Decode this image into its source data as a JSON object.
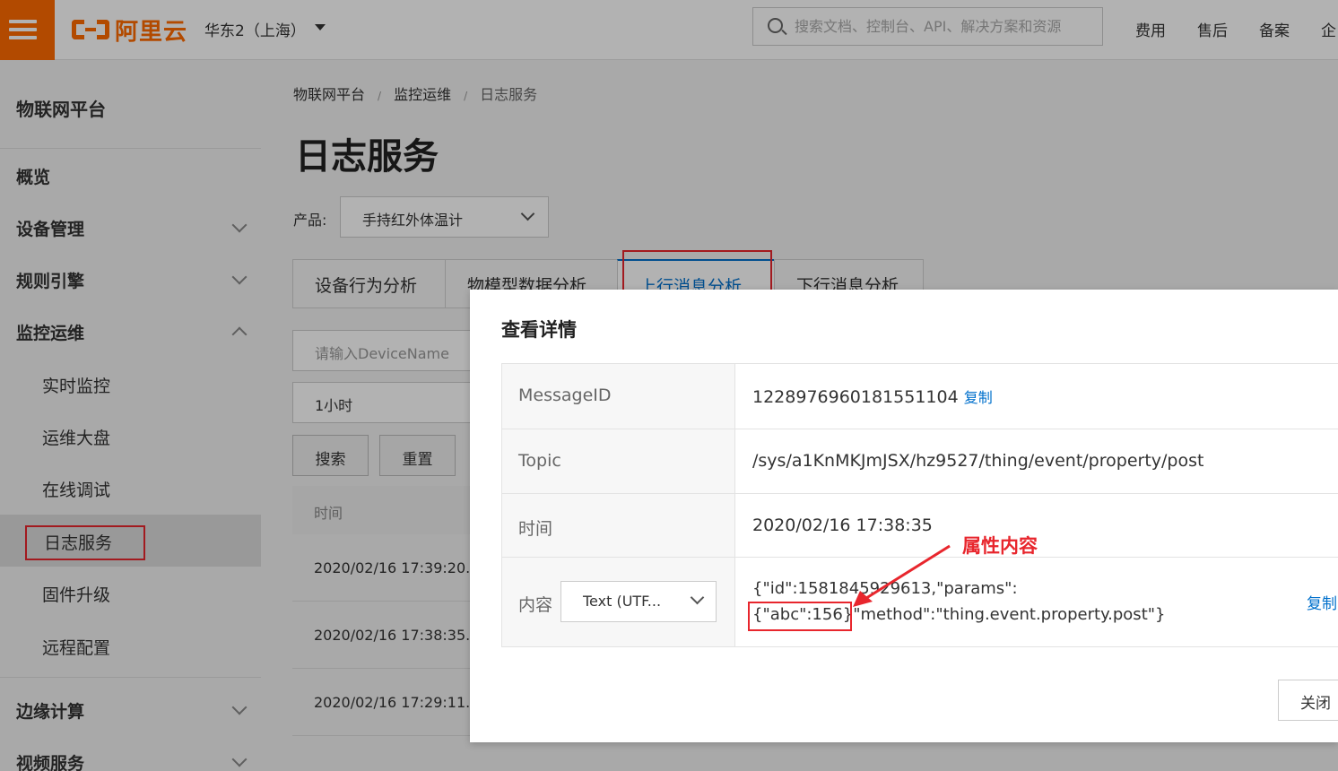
{
  "header": {
    "logo_text": "阿里云",
    "region": "华东2（上海）",
    "search_placeholder": "搜索文档、控制台、API、解决方案和资源",
    "links": [
      "费用",
      "售后",
      "备案",
      "企"
    ]
  },
  "sidebar": {
    "title": "物联网平台",
    "items": [
      {
        "label": "概览"
      },
      {
        "label": "设备管理"
      },
      {
        "label": "规则引擎"
      },
      {
        "label": "监控运维"
      },
      {
        "label": "实时监控"
      },
      {
        "label": "运维大盘"
      },
      {
        "label": "在线调试"
      },
      {
        "label": "日志服务"
      },
      {
        "label": "固件升级"
      },
      {
        "label": "远程配置"
      },
      {
        "label": "边缘计算"
      },
      {
        "label": "视频服务"
      }
    ]
  },
  "main": {
    "breadcrumb": [
      "物联网平台",
      "/",
      "监控运维",
      "/",
      "日志服务"
    ],
    "title": "日志服务",
    "product_label": "产品:",
    "product_value": "手持红外体温计",
    "tabs": [
      "设备行为分析",
      "物模型数据分析",
      "上行消息分析",
      "下行消息分析"
    ],
    "device_input_placeholder": "请输入DeviceName",
    "time_range": "1小时",
    "search_button": "搜索",
    "reset_button": "重置",
    "table_header_time": "时间",
    "rows": [
      "2020/02/16 17:39:20.",
      "2020/02/16 17:38:35.",
      "2020/02/16 17:29:11."
    ]
  },
  "modal": {
    "title": "查看详情",
    "message_id_label": "MessageID",
    "message_id_value": "1228976960181551104",
    "copy_label": "复制",
    "topic_label": "Topic",
    "topic_value": "/sys/a1KnMKJmJSX/hz9527/thing/event/property/post",
    "time_label": "时间",
    "time_value": "2020/02/16 17:38:35",
    "content_label": "内容",
    "encoding": "Text (UTF...",
    "content_line1": "{\"id\":1581845929613,\"params\":",
    "content_line2": "{\"abc\":156}\"method\":\"thing.event.property.post\"}",
    "annotation": "属性内容",
    "copy_content_label": "复制",
    "close_button": "关闭"
  },
  "colors": {
    "brand": "#ff6a00",
    "link": "#0070cc",
    "highlight": "#e8262d"
  }
}
